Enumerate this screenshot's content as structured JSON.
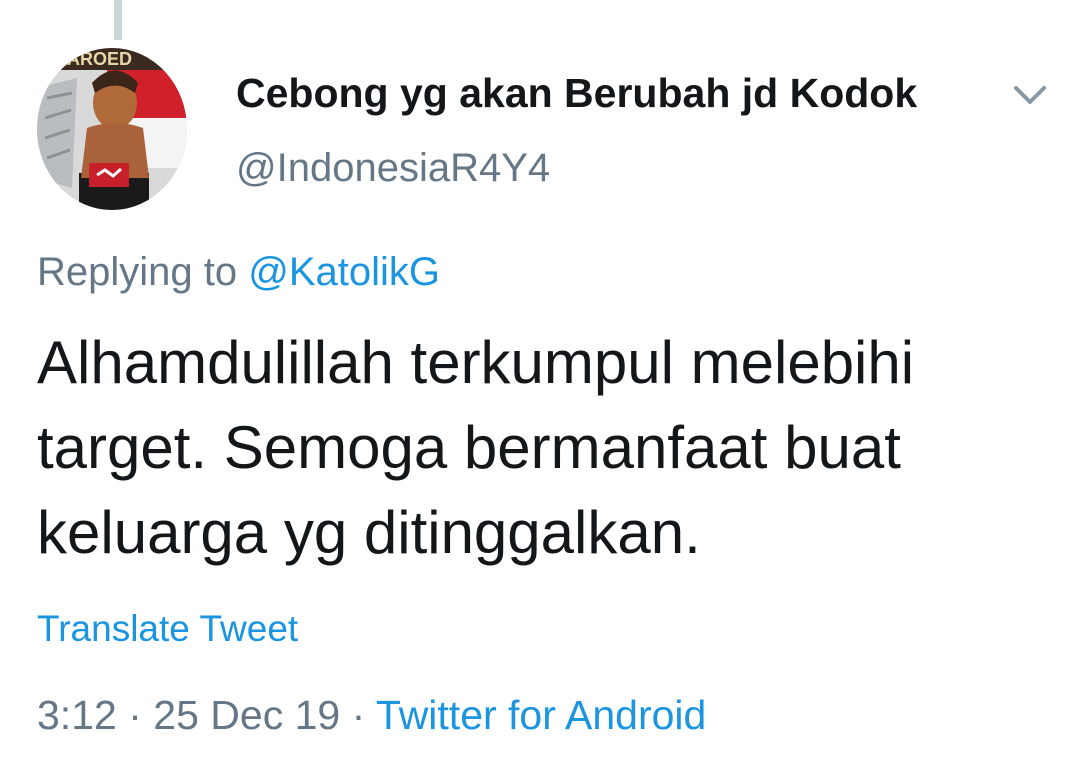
{
  "tweet": {
    "author": {
      "display_name": "Cebong yg akan Berubah jd Kodok",
      "handle": "@IndonesiaR4Y4",
      "avatar_text": "AROED"
    },
    "menu_icon": "chevron-down-icon",
    "reply": {
      "prefix": "Replying to",
      "mention": "@KatolikG"
    },
    "text": "Alhamdulillah terkumpul melebihi target. Semoga bermanfaat buat keluarga yg ditinggalkan.",
    "translate_label": "Translate Tweet",
    "meta": {
      "time": "3:12",
      "separator": "·",
      "date": "25 Dec 19",
      "source": "Twitter for Android"
    }
  },
  "colors": {
    "text_primary": "#14171a",
    "text_secondary": "#657786",
    "link": "#1b95e0",
    "thread_line": "#ccd6dd"
  }
}
